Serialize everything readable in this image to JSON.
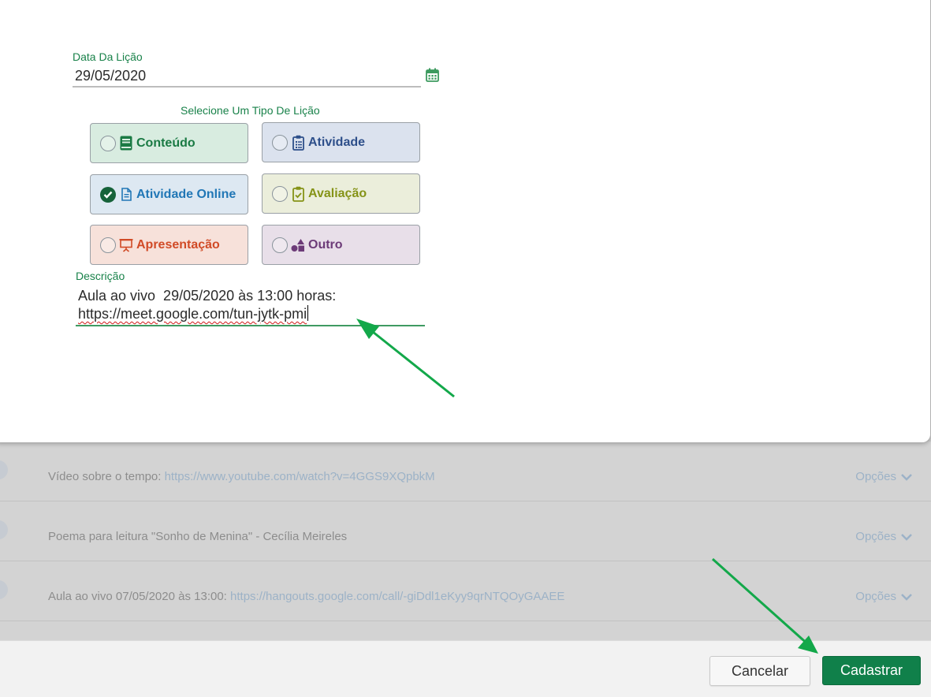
{
  "form": {
    "date_label": "Data Da Lição",
    "date_value": "29/05/2020",
    "type_title": "Selecione Um Tipo De Lição",
    "types": [
      {
        "label": "Conteúdo",
        "icon": "book-icon",
        "checked": false
      },
      {
        "label": "Atividade",
        "icon": "clipboard-list-icon",
        "checked": false
      },
      {
        "label": "Atividade Online",
        "icon": "file-text-icon",
        "checked": true
      },
      {
        "label": "Avaliação",
        "icon": "clipboard-check-icon",
        "checked": false
      },
      {
        "label": "Apresentação",
        "icon": "presentation-icon",
        "checked": false
      },
      {
        "label": "Outro",
        "icon": "shapes-icon",
        "checked": false
      }
    ],
    "description_label": "Descrição",
    "description_line1": "Aula ao vivo  29/05/2020 às 13:00 horas:",
    "description_line2": "https://meet.google.com/tun-jytk-pmi"
  },
  "background_list": [
    {
      "text": "Vídeo sobre o tempo: ",
      "link": "https://www.youtube.com/watch?v=4GGS9XQpbkM",
      "options": "Opções"
    },
    {
      "text": "Poema para leitura \"Sonho de Menina\" - Cecília Meireles",
      "link": "",
      "options": "Opções"
    },
    {
      "text": "Aula ao vivo 07/05/2020 às 13:00: ",
      "link": "https://hangouts.google.com/call/-giDdl1eKyy9qrNTQOyGAAEE",
      "options": "Opções"
    }
  ],
  "footer": {
    "cancel_label": "Cancelar",
    "submit_label": "Cadastrar"
  },
  "colors": {
    "accent": "#10804a",
    "annotation_arrow": "#13a84a"
  }
}
